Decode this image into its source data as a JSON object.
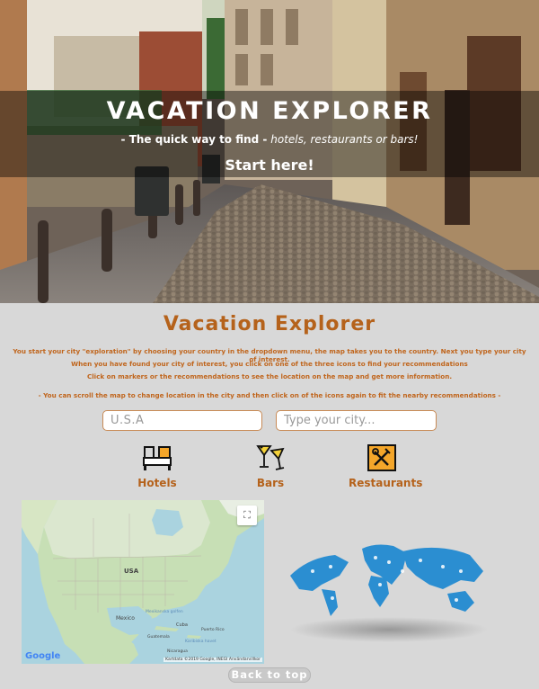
{
  "hero": {
    "title": "VACATION EXPLORER",
    "subtitle_lead": "- The quick way to find -",
    "subtitle_rest": "hotels, restaurants or bars!",
    "cta": "Start here!"
  },
  "main": {
    "title": "Vacation Explorer",
    "intro_lines": [
      "You start your city \"exploration\" by choosing your country in the dropdown menu, the map takes you to the country. Next you type your city of interest.",
      "When you have found your city of interest, you click on one of the three icons to find your recommendations",
      "Click on markers or the recommendations to see the location on the map and get more information.",
      "- You can scroll the map to change location in the city and then click on of the icons again to fit the nearby recommendations -"
    ],
    "country_value": "U.S.A",
    "city_placeholder": "Type your city..."
  },
  "categories": [
    {
      "label": "Hotels",
      "icon": "bed-icon"
    },
    {
      "label": "Bars",
      "icon": "cocktail-icon"
    },
    {
      "label": "Restaurants",
      "icon": "fork-knife-icon"
    }
  ],
  "map": {
    "credits": "Kartdata ©2019 Google, INEGI   Användarvillkor",
    "google": "Google",
    "labels": {
      "usa": "USA",
      "mexico": "Mexico",
      "cuba": "Cuba",
      "gulf": "Mexikanska golfen",
      "caribbean": "Karibiska havet",
      "guatemala": "Guatemala",
      "nicaragua": "Nicaragua",
      "puerto": "Puerto Rico"
    }
  },
  "footer": {
    "back_to_top": "Back to top"
  },
  "colors": {
    "accent": "#b5621b",
    "page_bg": "#d8d8d8"
  }
}
